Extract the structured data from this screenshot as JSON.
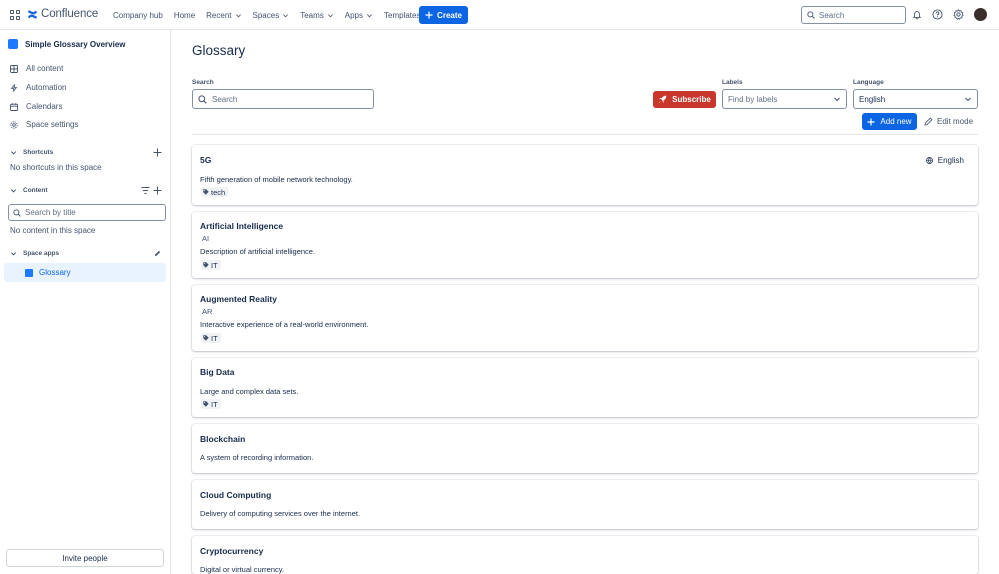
{
  "header": {
    "logo_text": "Confluence",
    "nav": [
      "Company hub",
      "Home",
      "Recent",
      "Spaces",
      "Teams",
      "Apps",
      "Templates"
    ],
    "create_label": "Create",
    "search_placeholder": "Search"
  },
  "sidebar": {
    "space_title": "Simple Glossary Overview",
    "items": [
      "All content",
      "Automation",
      "Calendars",
      "Space settings"
    ],
    "shortcuts_label": "Shortcuts",
    "no_shortcuts": "No shortcuts in this space",
    "content_label": "Content",
    "title_search_placeholder": "Search by title",
    "no_content": "No content in this space",
    "space_apps_label": "Space apps",
    "glossary_label": "Glossary",
    "invite_label": "Invite people"
  },
  "main": {
    "title": "Glossary",
    "search_label": "Search",
    "search_placeholder": "Search",
    "subscribe_label": "Subscribe",
    "labels_label": "Labels",
    "labels_placeholder": "Find by labels",
    "language_label": "Language",
    "language_value": "English",
    "add_new_label": "Add new",
    "edit_mode_label": "Edit mode"
  },
  "entries": [
    {
      "title": "5G",
      "abbr": "",
      "description": "Fifth generation of mobile network technology.",
      "tag": "tech",
      "language": "English"
    },
    {
      "title": "Artificial Intelligence",
      "abbr": "AI",
      "description": "Description of artificial intelligence.",
      "tag": "IT",
      "language": ""
    },
    {
      "title": "Augmented Reality",
      "abbr": "AR",
      "description": "Interactive experience of a real-world environment.",
      "tag": "IT",
      "language": ""
    },
    {
      "title": "Big Data",
      "abbr": "",
      "description": "Large and complex data sets.",
      "tag": "IT",
      "language": ""
    },
    {
      "title": "Blockchain",
      "abbr": "",
      "description": "A system of recording information.",
      "tag": "",
      "language": ""
    },
    {
      "title": "Cloud Computing",
      "abbr": "",
      "description": "Delivery of computing services over the internet.",
      "tag": "",
      "language": ""
    },
    {
      "title": "Cryptocurrency",
      "abbr": "",
      "description": "Digital or virtual currency.",
      "tag": "",
      "language": ""
    }
  ],
  "colors": {
    "accent": "#0c66e4",
    "subscribe": "#c9372c"
  }
}
